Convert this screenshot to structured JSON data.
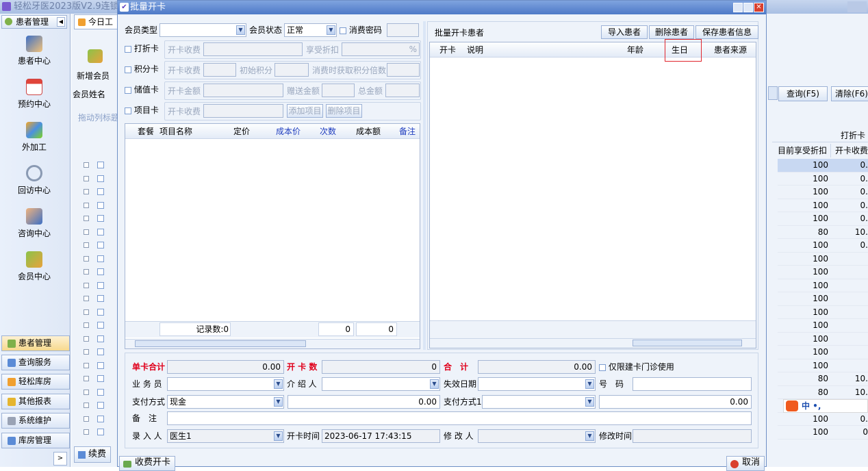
{
  "app": {
    "title": "轻松牙医2023版V2.9连锁"
  },
  "sidebar": {
    "tab": "患者管理",
    "items": [
      {
        "label": "患者中心"
      },
      {
        "label": "预约中心"
      },
      {
        "label": "外加工"
      },
      {
        "label": "回访中心"
      },
      {
        "label": "咨询中心"
      },
      {
        "label": "会员中心"
      }
    ],
    "nav": [
      {
        "label": "患者管理"
      },
      {
        "label": "查询服务"
      },
      {
        "label": "轻松库房"
      },
      {
        "label": "其他报表"
      },
      {
        "label": "系统维护"
      },
      {
        "label": "库房管理"
      }
    ]
  },
  "main": {
    "tab": "今日工",
    "new_member": "新增会员",
    "member_name_label": "会员姓名",
    "drag_hint": "拖动列标题",
    "query_btn": "查询(F5)",
    "clear_btn": "清除(F6)",
    "col_group": "打折卡",
    "col_discount": "目前享受折扣",
    "col_fee": "开卡收费",
    "rows": [
      {
        "d": "100",
        "f": "0."
      },
      {
        "d": "100",
        "f": "0."
      },
      {
        "d": "100",
        "f": "0."
      },
      {
        "d": "100",
        "f": "0."
      },
      {
        "d": "100",
        "f": "0."
      },
      {
        "d": "80",
        "f": "10."
      },
      {
        "d": "100",
        "f": "0."
      },
      {
        "d": "100",
        "f": ""
      },
      {
        "d": "100",
        "f": ""
      },
      {
        "d": "100",
        "f": ""
      },
      {
        "d": "100",
        "f": ""
      },
      {
        "d": "100",
        "f": ""
      },
      {
        "d": "100",
        "f": ""
      },
      {
        "d": "100",
        "f": ""
      },
      {
        "d": "100",
        "f": ""
      },
      {
        "d": "100",
        "f": ""
      },
      {
        "d": "80",
        "f": "10."
      },
      {
        "d": "80",
        "f": "10."
      },
      {
        "d": "",
        "f": ""
      },
      {
        "d": "100",
        "f": "0."
      },
      {
        "d": "100",
        "f": "0"
      }
    ],
    "renew_btn": "续费",
    "ime": "中 •,"
  },
  "dialog": {
    "title": "批量开卡",
    "member_type_label": "会员类型",
    "member_status_label": "会员状态",
    "member_status_value": "正常",
    "consume_pwd_label": "消费密码",
    "discount_card": "打折卡",
    "points_card": "积分卡",
    "stored_card": "储值卡",
    "item_card": "项目卡",
    "open_fee": "开卡收费",
    "enjoy_discount": "享受折扣",
    "percent": "%",
    "init_points": "初始积分",
    "points_multiple": "消费时获取积分倍数",
    "open_amount": "开卡金额",
    "gift_amount": "赠送金额",
    "total_amount": "总金额",
    "add_item": "添加项目",
    "del_item": "删除项目",
    "item_cols": [
      "套餐",
      "项目名称",
      "定价",
      "成本价",
      "次数",
      "成本额",
      "备注"
    ],
    "records": "记录数:0",
    "sum1": "0",
    "sum2": "0",
    "patient_title": "批量开卡患者",
    "import_btn": "导入患者",
    "delete_btn": "删除患者",
    "save_btn": "保存患者信息",
    "patient_cols": [
      "开卡",
      "说明",
      "年龄",
      "生日",
      "患者来源"
    ],
    "single_total_label": "单卡合计",
    "single_total": "0.00",
    "card_count_label": "开 卡 数",
    "card_count": "0",
    "total_label": "合　计",
    "total": "0.00",
    "only_clinic": "仅限建卡门诊使用",
    "salesman": "业 务 员",
    "referrer": "介 绍 人",
    "expire": "失效日期",
    "number": "号　码",
    "pay_method": "支付方式",
    "pay_value": "现金",
    "pay_amount": "0.00",
    "pay_method1": "支付方式1",
    "pay_amount1": "0.00",
    "remark": "备　注",
    "entry_person": "录 入 人",
    "entry_value": "医生1",
    "open_time_label": "开卡时间",
    "open_time": "2023-06-17 17:43:15",
    "modifier": "修 改 人",
    "modify_time": "修改时间",
    "charge_btn": "收费开卡",
    "cancel_btn": "取消"
  }
}
